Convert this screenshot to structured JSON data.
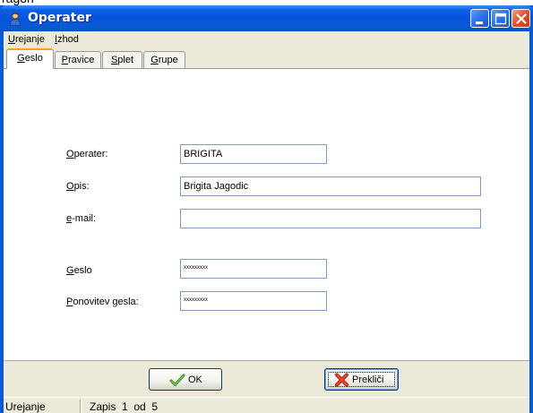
{
  "caption_fragment": "ragon",
  "window": {
    "title": "Operater",
    "icon": "user-app-icon",
    "controls": [
      "minimize-icon",
      "maximize-icon",
      "close-icon"
    ]
  },
  "menu": {
    "items": [
      {
        "key": "U",
        "rest": "rejanje"
      },
      {
        "key": "I",
        "rest": "zhod"
      }
    ]
  },
  "tabs": [
    {
      "key": "G",
      "rest": "eslo",
      "active": true
    },
    {
      "key": "P",
      "rest": "ravice",
      "active": false
    },
    {
      "key": "S",
      "rest": "plet",
      "active": false
    },
    {
      "key": "G",
      "rest": "rupe",
      "active": false
    }
  ],
  "form": {
    "operater": {
      "key": "O",
      "rest": "perater:",
      "value": "BRIGITA"
    },
    "opis": {
      "key": "O",
      "rest": "pis:",
      "value": "Brigita Jagodic"
    },
    "email": {
      "key": "e",
      "rest": "-mail:",
      "value": ""
    },
    "geslo": {
      "key": "G",
      "rest": "eslo",
      "value": "xxxxxxxxx"
    },
    "ponovitev": {
      "key": "P",
      "rest": "onovitev gesla:",
      "value": "xxxxxxxxx"
    }
  },
  "buttons": {
    "ok": {
      "label": "OK",
      "icon": "checkmark-icon"
    },
    "cancel": {
      "label": "Prekliči",
      "icon": "red-x-icon"
    }
  },
  "status": {
    "mode": "Urejanje",
    "record": "Zapis  1  od  5"
  },
  "colors": {
    "titlebar": "#0a5ad8",
    "face": "#ece9d8",
    "active_tab_accent": "#f4a42a",
    "field_border": "#7f9db9"
  }
}
